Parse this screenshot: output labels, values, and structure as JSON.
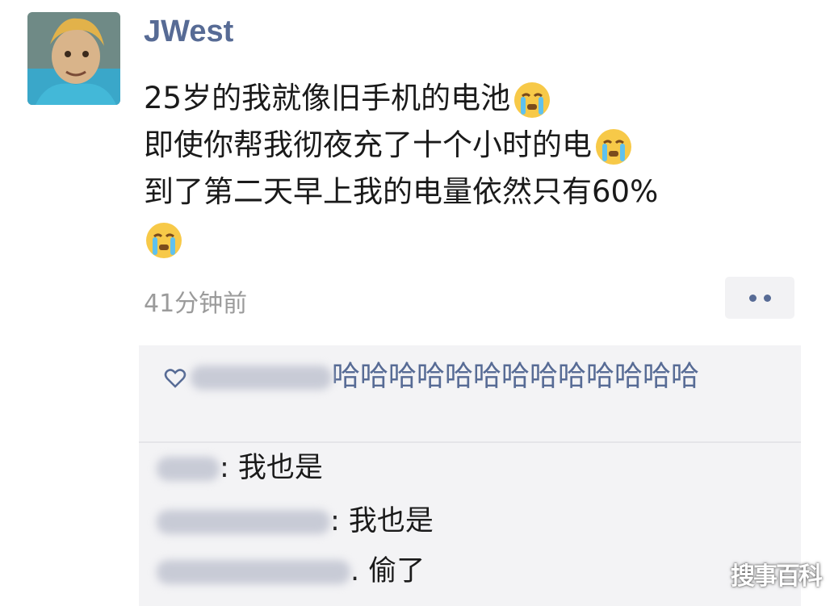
{
  "post": {
    "username": "JWest",
    "lines": [
      "25岁的我就像旧手机的电池",
      "即使你帮我彻夜充了十个小时的电",
      "到了第二天早上我的电量依然只有60%",
      ""
    ],
    "emoji_name": "crying-face-emoji",
    "timestamp": "41分钟前"
  },
  "comments": {
    "like_text": "哈哈哈哈哈哈哈哈哈哈哈哈哈",
    "items": [
      {
        "text": "我也是"
      },
      {
        "text": "我也是"
      },
      {
        "text": "偷了"
      }
    ]
  },
  "watermark": "搜事百科",
  "colors": {
    "name_blue": "#576b95",
    "comment_bg": "#f3f3f5",
    "timestamp_gray": "#9b9b9b"
  }
}
